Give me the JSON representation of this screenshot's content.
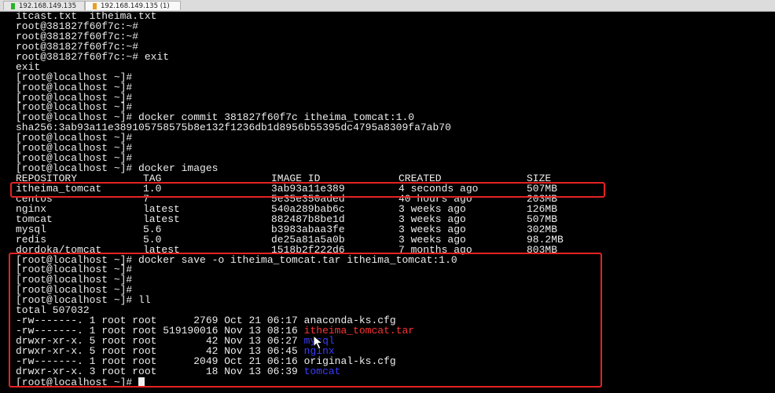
{
  "tabs": [
    {
      "label": "192.168.149.135",
      "indicator_color": "#28b428"
    },
    {
      "label": "192.168.149.135 (1)",
      "indicator_color": "#e8a020"
    }
  ],
  "terminal": {
    "pre_lines": [
      "itcast.txt  itheima.txt",
      "root@381827f60f7c:~#",
      "root@381827f60f7c:~#",
      "root@381827f60f7c:~#",
      "root@381827f60f7c:~# exit",
      "exit",
      "[root@localhost ~]#",
      "[root@localhost ~]#",
      "[root@localhost ~]#",
      "[root@localhost ~]#",
      "[root@localhost ~]# docker commit 381827f60f7c itheima_tomcat:1.0",
      "sha256:3ab93a11e389105758575b8e132f1236db1d8956b55395dc4795a8309fa7ab70",
      "[root@localhost ~]#",
      "[root@localhost ~]#",
      "[root@localhost ~]#",
      "[root@localhost ~]# docker images"
    ],
    "images_header": {
      "repository": "REPOSITORY",
      "tag": "TAG",
      "image_id": "IMAGE ID",
      "created": "CREATED",
      "size": "SIZE"
    },
    "images": [
      {
        "repository": "itheima_tomcat",
        "tag": "1.0",
        "image_id": "3ab93a11e389",
        "created": "4 seconds ago",
        "size": "507MB"
      },
      {
        "repository": "centos",
        "tag": "7",
        "image_id": "5e35e350aded",
        "created": "40 hours ago",
        "size": "203MB"
      },
      {
        "repository": "nginx",
        "tag": "latest",
        "image_id": "540a289bab6c",
        "created": "3 weeks ago",
        "size": "126MB"
      },
      {
        "repository": "tomcat",
        "tag": "latest",
        "image_id": "882487b8be1d",
        "created": "3 weeks ago",
        "size": "507MB"
      },
      {
        "repository": "mysql",
        "tag": "5.6",
        "image_id": "b3983abaa3fe",
        "created": "3 weeks ago",
        "size": "302MB"
      },
      {
        "repository": "redis",
        "tag": "5.0",
        "image_id": "de25a81a5a0b",
        "created": "3 weeks ago",
        "size": "98.2MB"
      },
      {
        "repository": "dordoka/tomcat",
        "tag": "latest",
        "image_id": "1518b2f222d6",
        "created": "7 months ago",
        "size": "803MB"
      }
    ],
    "post_lines": [
      "[root@localhost ~]# docker save -o itheima_tomcat.tar itheima_tomcat:1.0",
      "[root@localhost ~]#",
      "[root@localhost ~]#",
      "[root@localhost ~]#",
      "[root@localhost ~]# ll",
      "total 507032"
    ],
    "files": [
      {
        "info": "-rw-------. 1 root root      2769 Oct 21 06:17 ",
        "name": "anaconda-ks.cfg",
        "kind": "file"
      },
      {
        "info": "-rw-------. 1 root root 519190016 Nov 13 08:16 ",
        "name": "itheima_tomcat.tar",
        "kind": "archive"
      },
      {
        "info": "drwxr-xr-x. 5 root root        42 Nov 13 06:27 ",
        "name": "mysql",
        "kind": "dir"
      },
      {
        "info": "drwxr-xr-x. 5 root root        42 Nov 13 06:45 ",
        "name": "nginx",
        "kind": "dir"
      },
      {
        "info": "-rw-------. 1 root root      2049 Oct 21 06:16 ",
        "name": "original-ks.cfg",
        "kind": "file"
      },
      {
        "info": "drwxr-xr-x. 3 root root        18 Nov 13 06:39 ",
        "name": "tomcat",
        "kind": "dir"
      }
    ],
    "prompt": "[root@localhost ~]# "
  },
  "colors": {
    "background": "#000000",
    "text": "#ededed",
    "highlight_box": "#e52222",
    "archive": "#ff3333",
    "directory": "#3b3bff"
  },
  "icons": {
    "cursor": "mouse-pointer-icon"
  }
}
